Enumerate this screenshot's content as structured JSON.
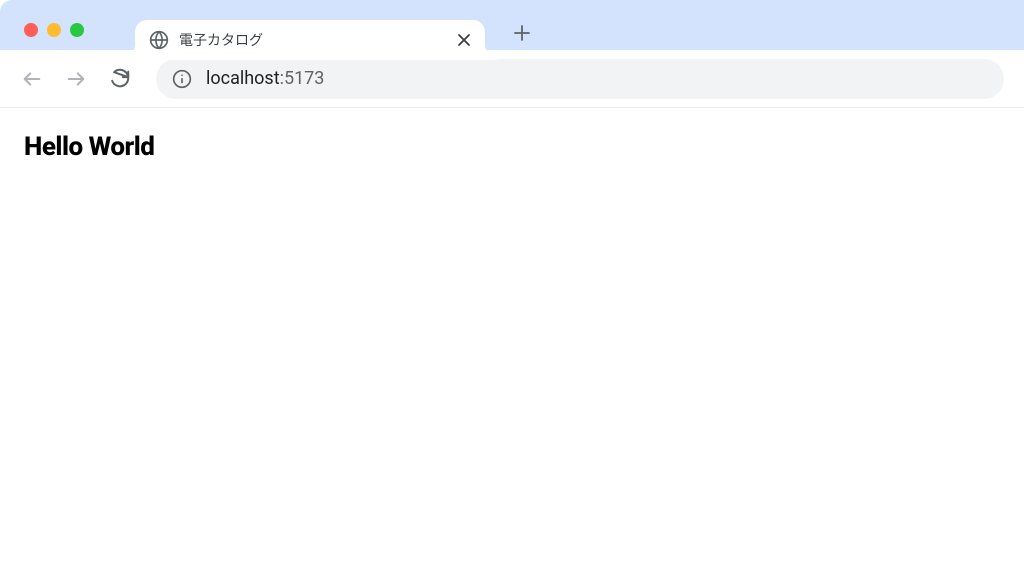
{
  "browser": {
    "tab": {
      "title": "電子カタログ",
      "favicon": "globe-icon"
    },
    "toolbar": {
      "url_host": "localhost",
      "url_port": ":5173"
    }
  },
  "page": {
    "heading": "Hello World"
  }
}
